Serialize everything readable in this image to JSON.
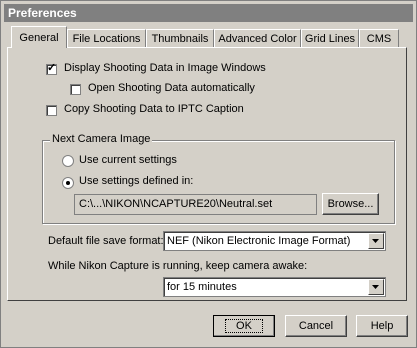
{
  "window": {
    "title": "Preferences"
  },
  "tabs": [
    {
      "label": "General",
      "active": true
    },
    {
      "label": "File Locations"
    },
    {
      "label": "Thumbnails"
    },
    {
      "label": "Advanced Color"
    },
    {
      "label": "Grid Lines"
    },
    {
      "label": "CMS"
    }
  ],
  "general": {
    "display_shooting_data": {
      "label": "Display Shooting Data in Image Windows",
      "checked": true
    },
    "open_shooting_data_auto": {
      "label": "Open Shooting Data automatically",
      "checked": false
    },
    "copy_to_iptc": {
      "label": "Copy Shooting Data to IPTC Caption",
      "checked": false
    },
    "next_camera_image": {
      "title": "Next Camera Image",
      "use_current": {
        "label": "Use current settings",
        "selected": false
      },
      "use_defined": {
        "label": "Use settings defined in:",
        "selected": true
      },
      "path": "C:\\...\\NIKON\\NCAPTURE20\\Neutral.set",
      "browse_label": "Browse..."
    },
    "default_format": {
      "label": "Default file save format:",
      "value": "NEF (Nikon Electronic Image Format)"
    },
    "keep_awake": {
      "label": "While Nikon Capture is running, keep camera awake:",
      "value": "for 15 minutes"
    }
  },
  "buttons": {
    "ok": "OK",
    "cancel": "Cancel",
    "help": "Help"
  }
}
